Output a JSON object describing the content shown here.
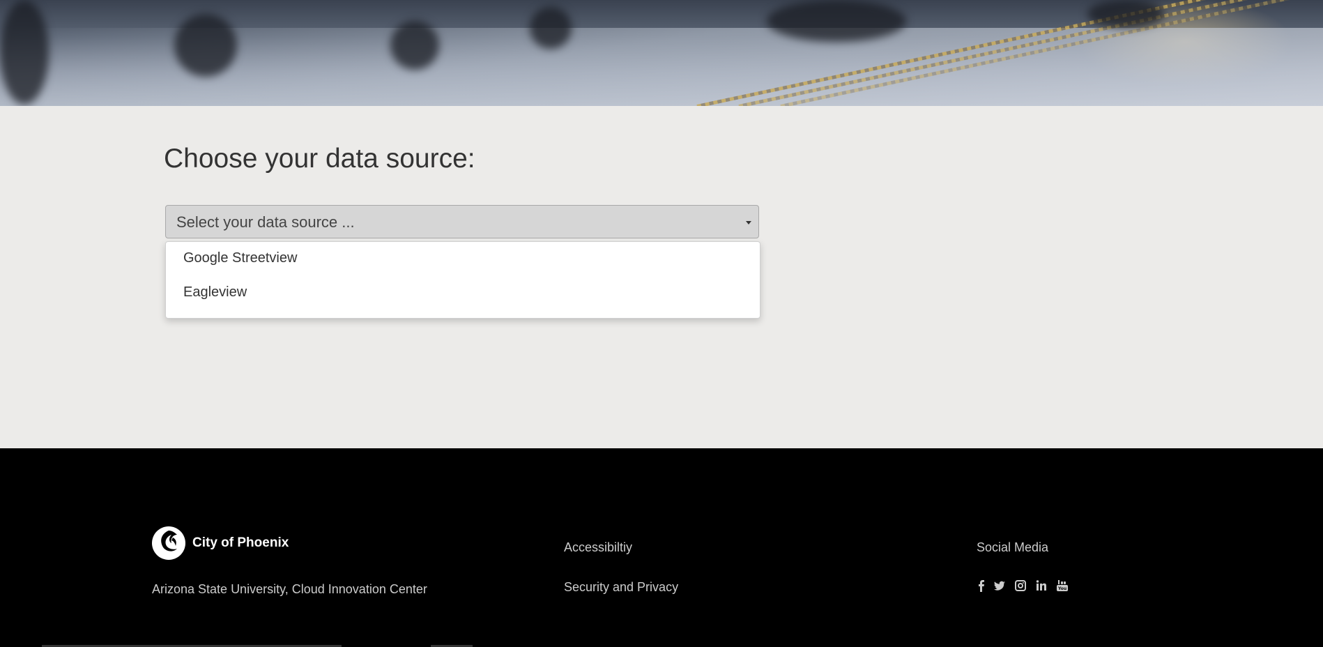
{
  "main": {
    "title": "Choose your data source:",
    "select": {
      "placeholder": "Select your data source ...",
      "options": [
        "Google Streetview",
        "Eagleview"
      ]
    }
  },
  "footer": {
    "logo_text": "City of Phoenix",
    "org": "Arizona State University, Cloud Innovation Center",
    "links": [
      "Accessibiltiy",
      "Security and Privacy"
    ],
    "social_heading": "Social Media",
    "social_icons": [
      "facebook-icon",
      "twitter-icon",
      "instagram-icon",
      "linkedin-icon",
      "youtube-icon"
    ]
  },
  "colors": {
    "content_bg": "#ecebe9",
    "footer_bg": "#000000",
    "select_bg": "#d6d6d6"
  }
}
